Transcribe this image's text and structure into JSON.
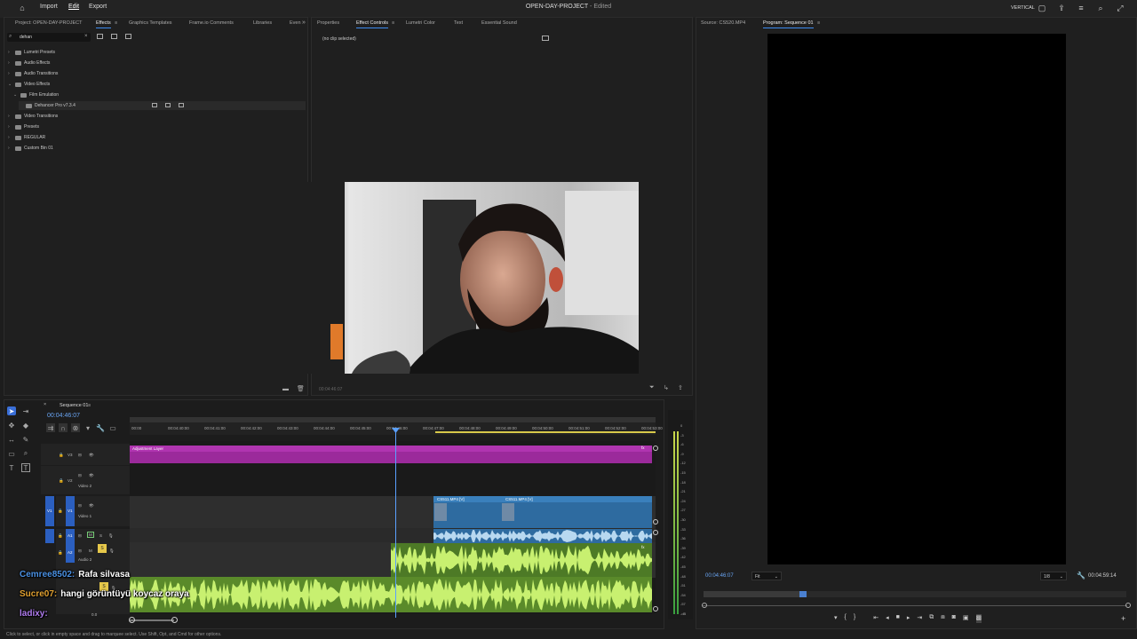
{
  "menu": {
    "import": "Import",
    "edit": "Edit",
    "export": "Export"
  },
  "title": {
    "project": "OPEN-DAY-PROJECT",
    "state": " - Edited"
  },
  "workspace": "VERTICAL",
  "left_panel": {
    "tabs": [
      "Project: OPEN-DAY-PROJECT",
      "Effects",
      "Graphics Templates",
      "Frame.io Comments",
      "Libraries",
      "Even"
    ],
    "search_value": "dehan",
    "tree": [
      {
        "label": "Lumetri Presets",
        "level": 0,
        "open": false
      },
      {
        "label": "Audio Effects",
        "level": 0,
        "open": false
      },
      {
        "label": "Audio Transitions",
        "level": 0,
        "open": false
      },
      {
        "label": "Video Effects",
        "level": 0,
        "open": true
      },
      {
        "label": "Film Emulation",
        "level": 1,
        "open": true
      },
      {
        "label": "Dehancer Pro  v7.3.4",
        "level": 2,
        "open": false
      },
      {
        "label": "Video Transitions",
        "level": 0,
        "open": false
      },
      {
        "label": "Presets",
        "level": 0,
        "open": false
      },
      {
        "label": "REGULAR",
        "level": 0,
        "open": false
      },
      {
        "label": "Custom Bin 01",
        "level": 0,
        "open": false
      }
    ]
  },
  "mid_panel": {
    "tabs": [
      "Properties",
      "Effect Controls",
      "Lumetri Color",
      "Text",
      "Essential Sound"
    ],
    "no_clip": "(no clip selected)",
    "timecode": "00:04:46:07"
  },
  "right_panel": {
    "tabs": [
      "Source: CS520.MP4",
      "Program: Sequence 01"
    ],
    "timecode": "00:04:46:07",
    "fit": "Fit",
    "ratio": "1/8",
    "duration": "00:04:59:14"
  },
  "timeline": {
    "sequence": "Sequence 01",
    "timecode": "00:04:46:07",
    "ruler": [
      "00:00",
      "00:04:40:00",
      "00:04:41:00",
      "00:04:42:00",
      "00:04:43:00",
      "00:04:44:00",
      "00:04:45:00",
      "00:04:46:00",
      "00:04:47:00",
      "00:04:48:00",
      "00:04:49:00",
      "00:04:50:00",
      "00:04:51:00",
      "00:04:52:00",
      "00:04:53:00"
    ],
    "tracks": {
      "v3": "V3",
      "v2": "V2",
      "v2name": "Video 2",
      "v1": "V1",
      "v1name": "Video 1",
      "a1": "A1",
      "a2": "A2",
      "a2name": "Audio 2",
      "a3": "A3"
    },
    "adjustment_layer": "Adjustment Layer",
    "clip1": "CS511.MP4 [V]",
    "clip2": "CS511.MP4 [V]",
    "master_val": "0.0"
  },
  "meter_labels": [
    "0",
    "-3",
    "-6",
    "-9",
    "-12",
    "-15",
    "-18",
    "-21",
    "-24",
    "-27",
    "-30",
    "-33",
    "-36",
    "-39",
    "-42",
    "-45",
    "-48",
    "-51",
    "-54",
    "-57",
    "-dB"
  ],
  "chat": [
    {
      "user": "Cemree8502:",
      "text": "Rafa silvasa",
      "color": "#4a90e2"
    },
    {
      "user": "Sucre07:",
      "text": "hangi görüntüyü koycaz oraya",
      "color": "#e0a030"
    },
    {
      "user": "ladixy:",
      "text": "",
      "color": "#b07cf0"
    }
  ],
  "status": "Click to select, or click in empty space and drag to marquee select. Use Shift, Opt, and Cmd for other options.",
  "colors": {
    "accent": "#3d8cf0",
    "adjustment": "#9b2a9b",
    "video_clip": "#2e6ba0",
    "audio_clip": "#5a8a2a",
    "audio_wave": "#c8f070"
  }
}
